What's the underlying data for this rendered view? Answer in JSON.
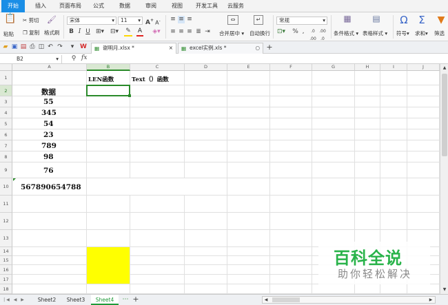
{
  "menu": {
    "tabs": [
      "开始",
      "插入",
      "页面布局",
      "公式",
      "数据",
      "审阅",
      "视图",
      "开发工具",
      "云服务"
    ]
  },
  "ribbon": {
    "paste": "粘贴",
    "cut": "剪切",
    "copy": "复制",
    "format_painter": "格式刷",
    "font_name": "宋体",
    "font_size": "11",
    "merge_center": "合并居中",
    "wrap_text": "自动换行",
    "number_format": "常规",
    "conditional_format": "条件格式",
    "table_style": "表格样式",
    "symbol": "符号",
    "sum": "求和",
    "filter": "筛选"
  },
  "doc_tabs": [
    {
      "label": "谢明月.xlsx *"
    },
    {
      "label": "excel实例.xls *"
    }
  ],
  "formula_bar": {
    "name_box": "B2",
    "fx": "fx",
    "formula": ""
  },
  "columns": [
    "A",
    "B",
    "C",
    "D",
    "E",
    "F",
    "G",
    "H",
    "I",
    "J"
  ],
  "rows": [
    "1",
    "2",
    "3",
    "4",
    "5",
    "6",
    "7",
    "8",
    "9",
    "10",
    "11",
    "12",
    "13",
    "14",
    "15",
    "16",
    "17",
    "18"
  ],
  "cells": {
    "b1": "LEN函数",
    "c1": "Text（）函数",
    "a2": "数据",
    "a3": "55",
    "a4": "345",
    "a5": "54",
    "a6": "23",
    "a7": "789",
    "a8": "98",
    "a9": "76",
    "a10": "567890654788"
  },
  "highlight_color": "#ffff00",
  "accent_color": "#1a8ee6",
  "sheets": [
    "Sheet2",
    "Sheet3",
    "Sheet4"
  ],
  "watermark": {
    "title": "百科全说",
    "subtitle": "助你轻松解决"
  }
}
